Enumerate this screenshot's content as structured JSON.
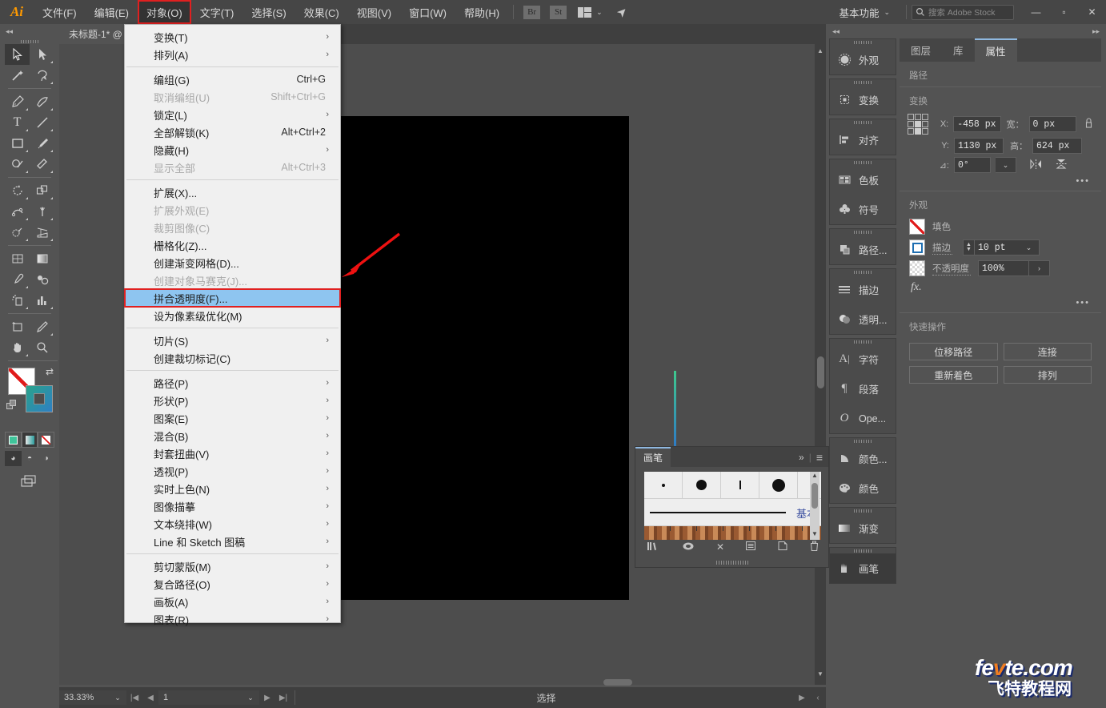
{
  "app": {
    "logo": "Ai"
  },
  "menubar": {
    "items": [
      {
        "label": "文件(F)",
        "active": false
      },
      {
        "label": "编辑(E)",
        "active": false
      },
      {
        "label": "对象(O)",
        "active": true
      },
      {
        "label": "文字(T)",
        "active": false
      },
      {
        "label": "选择(S)",
        "active": false
      },
      {
        "label": "效果(C)",
        "active": false
      },
      {
        "label": "视图(V)",
        "active": false
      },
      {
        "label": "窗口(W)",
        "active": false
      },
      {
        "label": "帮助(H)",
        "active": false
      }
    ],
    "bridge_label": "Br",
    "stock_label": "St",
    "workspace": "基本功能",
    "search_placeholder": "搜索 Adobe Stock",
    "minimize": "—",
    "maximize": "▫",
    "close": "✕"
  },
  "document": {
    "tab_title": "未标题-1* @"
  },
  "dropdown": {
    "groups": [
      [
        {
          "label": "变换(T)",
          "shortcut": "",
          "submenu": true,
          "disabled": false
        },
        {
          "label": "排列(A)",
          "shortcut": "",
          "submenu": true,
          "disabled": false
        }
      ],
      [
        {
          "label": "编组(G)",
          "shortcut": "Ctrl+G",
          "submenu": false,
          "disabled": false
        },
        {
          "label": "取消编组(U)",
          "shortcut": "Shift+Ctrl+G",
          "submenu": false,
          "disabled": true
        },
        {
          "label": "锁定(L)",
          "shortcut": "",
          "submenu": true,
          "disabled": false
        },
        {
          "label": "全部解锁(K)",
          "shortcut": "Alt+Ctrl+2",
          "submenu": false,
          "disabled": false
        },
        {
          "label": "隐藏(H)",
          "shortcut": "",
          "submenu": true,
          "disabled": false
        },
        {
          "label": "显示全部",
          "shortcut": "Alt+Ctrl+3",
          "submenu": false,
          "disabled": true
        }
      ],
      [
        {
          "label": "扩展(X)...",
          "shortcut": "",
          "submenu": false,
          "disabled": false
        },
        {
          "label": "扩展外观(E)",
          "shortcut": "",
          "submenu": false,
          "disabled": true
        },
        {
          "label": "裁剪图像(C)",
          "shortcut": "",
          "submenu": false,
          "disabled": true
        },
        {
          "label": "栅格化(Z)...",
          "shortcut": "",
          "submenu": false,
          "disabled": false
        },
        {
          "label": "创建渐变网格(D)...",
          "shortcut": "",
          "submenu": false,
          "disabled": false
        },
        {
          "label": "创建对象马赛克(J)...",
          "shortcut": "",
          "submenu": false,
          "disabled": true
        },
        {
          "label": "拼合透明度(F)...",
          "shortcut": "",
          "submenu": false,
          "disabled": false,
          "highlighted": true,
          "boxed": true
        },
        {
          "label": "设为像素级优化(M)",
          "shortcut": "",
          "submenu": false,
          "disabled": false
        }
      ],
      [
        {
          "label": "切片(S)",
          "shortcut": "",
          "submenu": true,
          "disabled": false
        },
        {
          "label": "创建裁切标记(C)",
          "shortcut": "",
          "submenu": false,
          "disabled": false
        }
      ],
      [
        {
          "label": "路径(P)",
          "shortcut": "",
          "submenu": true,
          "disabled": false
        },
        {
          "label": "形状(P)",
          "shortcut": "",
          "submenu": true,
          "disabled": false
        },
        {
          "label": "图案(E)",
          "shortcut": "",
          "submenu": true,
          "disabled": false
        },
        {
          "label": "混合(B)",
          "shortcut": "",
          "submenu": true,
          "disabled": false
        },
        {
          "label": "封套扭曲(V)",
          "shortcut": "",
          "submenu": true,
          "disabled": false
        },
        {
          "label": "透视(P)",
          "shortcut": "",
          "submenu": true,
          "disabled": false
        },
        {
          "label": "实时上色(N)",
          "shortcut": "",
          "submenu": true,
          "disabled": false
        },
        {
          "label": "图像描摹",
          "shortcut": "",
          "submenu": true,
          "disabled": false
        },
        {
          "label": "文本绕排(W)",
          "shortcut": "",
          "submenu": true,
          "disabled": false
        },
        {
          "label": "Line 和 Sketch 图稿",
          "shortcut": "",
          "submenu": true,
          "disabled": false
        }
      ],
      [
        {
          "label": "剪切蒙版(M)",
          "shortcut": "",
          "submenu": true,
          "disabled": false
        },
        {
          "label": "复合路径(O)",
          "shortcut": "",
          "submenu": true,
          "disabled": false
        },
        {
          "label": "画板(A)",
          "shortcut": "",
          "submenu": true,
          "disabled": false
        },
        {
          "label": "图表(R)",
          "shortcut": "",
          "submenu": true,
          "disabled": false
        }
      ]
    ]
  },
  "rightdock": {
    "rail_groups": [
      [
        {
          "label": "外观",
          "icon": "appearance-icon"
        }
      ],
      [
        {
          "label": "变换",
          "icon": "transform-icon"
        }
      ],
      [
        {
          "label": "对齐",
          "icon": "align-icon"
        }
      ],
      [
        {
          "label": "色板",
          "icon": "swatches-icon"
        },
        {
          "label": "符号",
          "icon": "symbols-icon"
        }
      ],
      [
        {
          "label": "路径...",
          "icon": "pathfinder-icon"
        }
      ],
      [
        {
          "label": "描边",
          "icon": "stroke-icon"
        },
        {
          "label": "透明...",
          "icon": "transparency-icon"
        }
      ],
      [
        {
          "label": "字符",
          "icon": "character-icon"
        },
        {
          "label": "段落",
          "icon": "paragraph-icon"
        },
        {
          "label": "Ope...",
          "icon": "opentype-icon"
        }
      ],
      [
        {
          "label": "颜色...",
          "icon": "color-guide-icon"
        },
        {
          "label": "颜色",
          "icon": "color-icon"
        }
      ],
      [
        {
          "label": "渐变",
          "icon": "gradient-icon"
        }
      ],
      [
        {
          "label": "画笔",
          "icon": "brushes-icon",
          "selected": true
        }
      ]
    ],
    "tabs": [
      {
        "label": "图层",
        "active": false
      },
      {
        "label": "库",
        "active": false
      },
      {
        "label": "属性",
        "active": true
      }
    ],
    "path_section_title": "路径",
    "transform": {
      "title": "变换",
      "x_label": "X:",
      "x_value": "-458 px",
      "y_label": "Y:",
      "y_value": "1130 px",
      "w_label": "宽：",
      "w_value": "0 px",
      "h_label": "高：",
      "h_value": "624 px",
      "angle_label": "⊿:",
      "angle_value": "0°"
    },
    "appearance": {
      "title": "外观",
      "fill_label": "填色",
      "stroke_label": "描边",
      "stroke_weight": "10 pt",
      "opacity_label": "不透明度",
      "opacity_value": "100%",
      "fx_label": "fx."
    },
    "quick_actions": {
      "title": "快速操作",
      "buttons": [
        "位移路径",
        "连接",
        "重新着色",
        "排列"
      ]
    }
  },
  "brushpanel": {
    "tab_label": "画笔",
    "basic_label": "基本",
    "collapse_icon": "»",
    "menu_icon": "≡"
  },
  "statusbar": {
    "zoom": "33.33%",
    "page": "1",
    "status_text": "选择"
  },
  "watermark": {
    "line1_a": "fe",
    "line1_b": "v",
    "line1_c": "te.com",
    "line2": "飞特教程网"
  }
}
